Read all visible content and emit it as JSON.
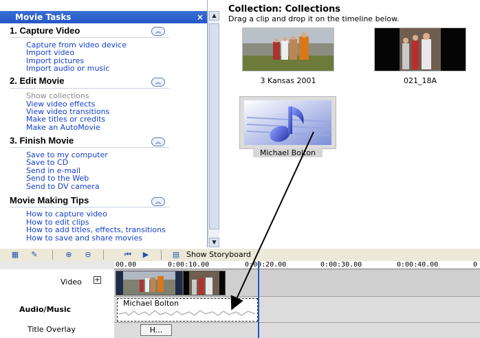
{
  "task_pane": {
    "header": "Movie Tasks",
    "close_glyph": "×",
    "sections": [
      {
        "title": "1. Capture Video",
        "links": [
          "Capture from video device",
          "Import video",
          "Import pictures",
          "Import audio or music"
        ]
      },
      {
        "title": "2. Edit Movie",
        "links": [
          "Show collections",
          "View video effects",
          "View video transitions",
          "Make titles or credits",
          "Make an AutoMovie"
        ]
      },
      {
        "title": "3. Finish Movie",
        "links": [
          "Save to my computer",
          "Save to CD",
          "Send in e-mail",
          "Send to the Web",
          "Send to DV camera"
        ]
      },
      {
        "title": "Movie Making Tips",
        "links": [
          "How to capture video",
          "How to edit clips",
          "How to add titles, effects, transitions",
          "How to save and share movies"
        ]
      }
    ],
    "collapse_glyph": "^"
  },
  "collection": {
    "title": "Collection: Collections",
    "hint": "Drag a clip and drop it on the timeline below.",
    "clips": [
      {
        "label": "3 Kansas 2001",
        "icon": "video-clip-thumbnail"
      },
      {
        "label": "021_18A",
        "icon": "video-clip-thumbnail"
      },
      {
        "label": "Michael Bolton",
        "icon": "music-note-icon",
        "selected": true
      }
    ]
  },
  "timeline": {
    "toolbar": {
      "show_storyboard_label": "Show Storyboard"
    },
    "ruler_labels": [
      "00.00",
      "0:00:10.00",
      "0:00:20.00",
      "0:00:30.00",
      "0:00:40.00",
      "0"
    ],
    "tracks": {
      "video_label": "Video",
      "video_expand": "+",
      "audio_label": "Audio/Music",
      "title_label": "Title Overlay"
    },
    "audio_clip_label": "Michael Bolton",
    "title_clip_label": "H..."
  },
  "colors": {
    "header_blue": "#2a5ccc",
    "link_blue": "#1540c7",
    "playhead_blue": "#1e5ac8"
  }
}
